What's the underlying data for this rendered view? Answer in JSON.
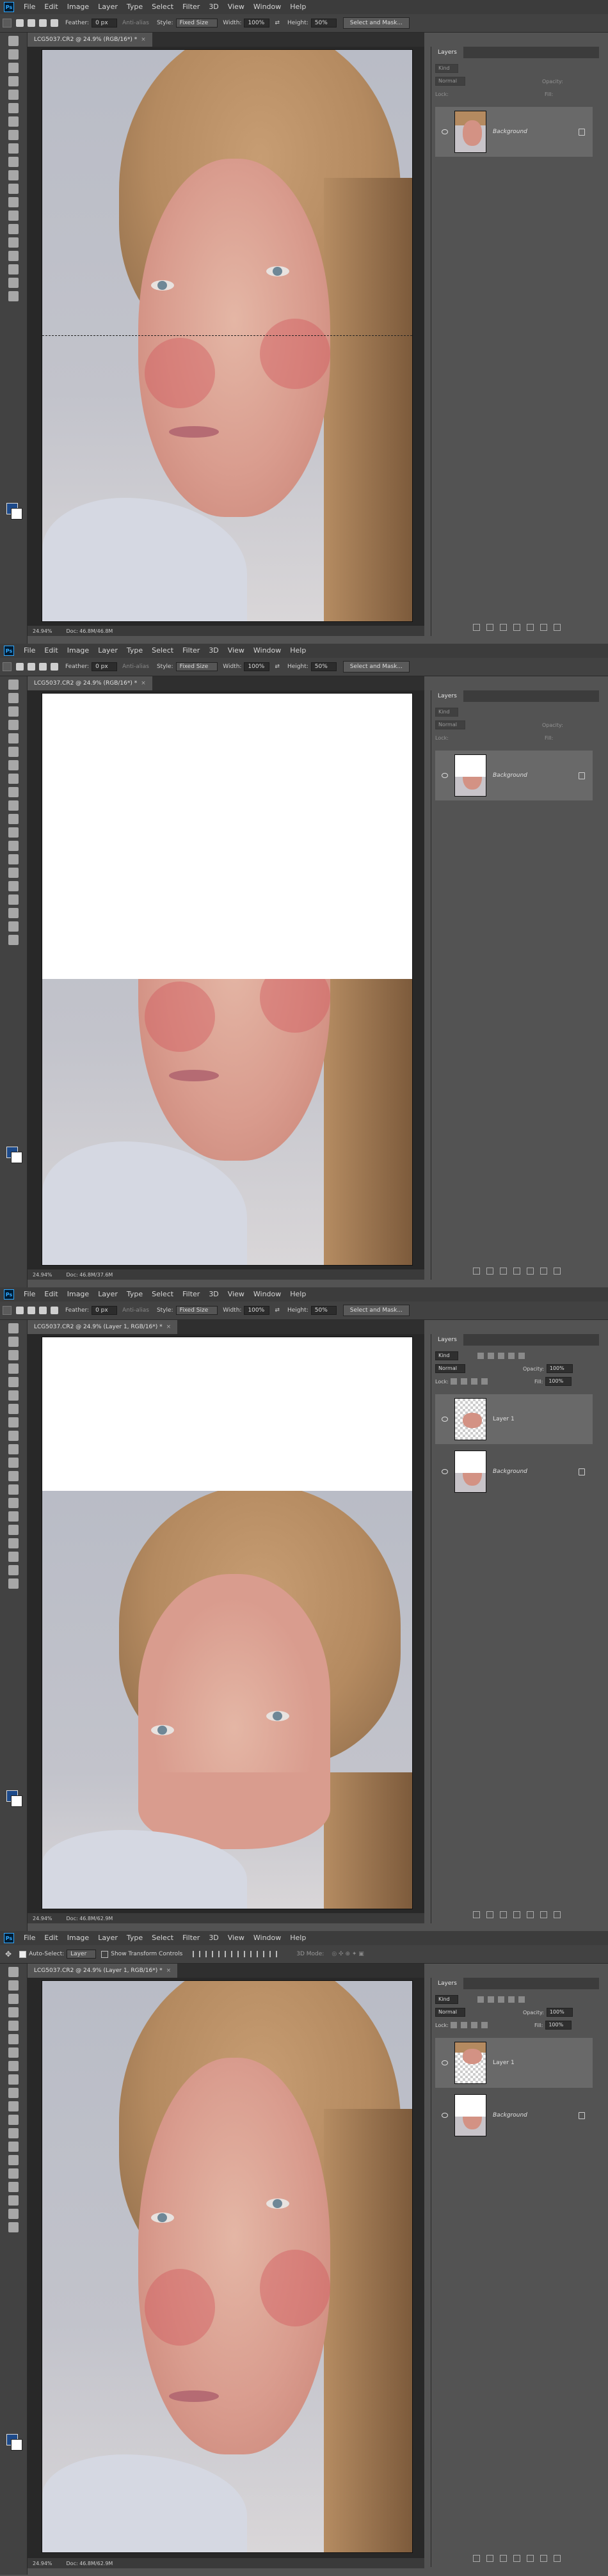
{
  "menu": [
    "File",
    "Edit",
    "Image",
    "Layer",
    "Type",
    "Select",
    "Filter",
    "3D",
    "View",
    "Window",
    "Help"
  ],
  "app_logo": "Ps",
  "marquee_options": {
    "feather_label": "Feather:",
    "feather_value": "0 px",
    "antialias_label": "Anti-alias",
    "style_label": "Style:",
    "style_value": "Fixed Size",
    "width_label": "Width:",
    "width_value": "100%",
    "height_label": "Height:",
    "height_value": "50%",
    "select_mask_label": "Select and Mask..."
  },
  "move_options": {
    "auto_select_label": "Auto-Select:",
    "auto_select_value": "Layer",
    "transform_label": "Show Transform Controls",
    "mode_3d_label": "3D Mode:"
  },
  "panels": [
    {
      "tab": "LCG5037.CR2 @ 24.9% (RGB/16*) *",
      "zoom": "24.94%",
      "doc": "Doc: 46.8M/46.8M",
      "layers": [
        {
          "name": "Background",
          "locked": true,
          "selected": true
        }
      ]
    },
    {
      "tab": "LCG5037.CR2 @ 24.9% (RGB/16*) *",
      "zoom": "24.94%",
      "doc": "Doc: 46.8M/37.6M",
      "layers": [
        {
          "name": "Background",
          "locked": true,
          "selected": true
        }
      ]
    },
    {
      "tab": "LCG5037.CR2 @ 24.9% (Layer 1, RGB/16*) *",
      "zoom": "24.94%",
      "doc": "Doc: 46.8M/62.9M",
      "layers": [
        {
          "name": "Layer 1",
          "locked": false,
          "selected": true
        },
        {
          "name": "Background",
          "locked": true,
          "selected": false
        }
      ]
    },
    {
      "tab": "LCG5037.CR2 @ 24.9% (Layer 1, RGB/16*) *",
      "zoom": "24.94%",
      "doc": "Doc: 46.8M/62.9M",
      "layers": [
        {
          "name": "Layer 1",
          "locked": false,
          "selected": true
        },
        {
          "name": "Background",
          "locked": true,
          "selected": false
        }
      ]
    }
  ],
  "layers_panel": {
    "tab": "Layers",
    "kind_label": "Kind",
    "blend_mode": "Normal",
    "opacity_label": "Opacity:",
    "opacity_value": "100%",
    "lock_label": "Lock:",
    "fill_label": "Fill:",
    "fill_value": "100%"
  },
  "colors": {
    "ui_bg": "#535353",
    "menubar": "#3c3c3c",
    "foreground_swatch": "#1d4a8a",
    "background_swatch": "#ffffff"
  },
  "icons": [
    "move-icon",
    "marquee-icon",
    "lasso-icon",
    "magic-wand-icon",
    "crop-icon",
    "eyedropper-icon",
    "healing-icon",
    "brush-icon",
    "stamp-icon",
    "history-brush-icon",
    "eraser-icon",
    "gradient-icon",
    "blur-icon",
    "dodge-icon",
    "pen-icon",
    "type-icon",
    "path-select-icon",
    "rectangle-icon",
    "hand-icon",
    "zoom-icon"
  ]
}
